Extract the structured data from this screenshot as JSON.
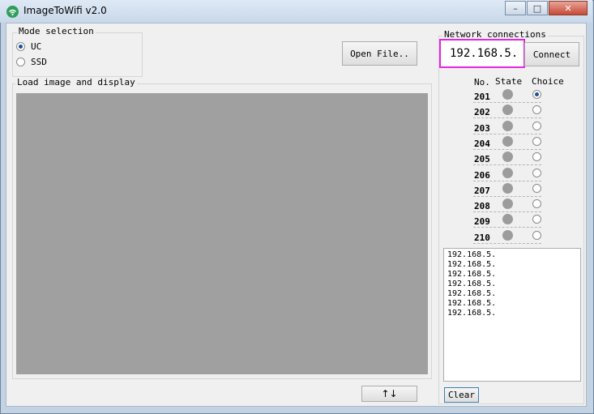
{
  "window": {
    "title": "ImageToWifi v2.0",
    "min_glyph": "–",
    "max_glyph": "□",
    "close_glyph": "✕"
  },
  "mode": {
    "title": "Mode selection",
    "options": [
      "UC",
      "SSD"
    ],
    "selected": "UC"
  },
  "open_file_label": "Open File..",
  "display": {
    "title": "Load image and display"
  },
  "swap_label": "↑↓",
  "network": {
    "title": "Network connections",
    "ip_value": "192.168.5.",
    "connect_label": "Connect",
    "headers": {
      "no": "No.",
      "state": "State",
      "choice": "Choice"
    },
    "nodes": [
      "201",
      "202",
      "203",
      "204",
      "205",
      "206",
      "207",
      "208",
      "209",
      "210"
    ],
    "selected_node": "201"
  },
  "log": {
    "lines": [
      "192.168.5.",
      "192.168.5.",
      "192.168.5.",
      "192.168.5.",
      "192.168.5.",
      "192.168.5.",
      "192.168.5."
    ]
  },
  "clear_label": "Clear",
  "colors": {
    "highlight": "#e426e4",
    "canvas": "#a0a0a0",
    "led_off": "#9c9c9c"
  }
}
